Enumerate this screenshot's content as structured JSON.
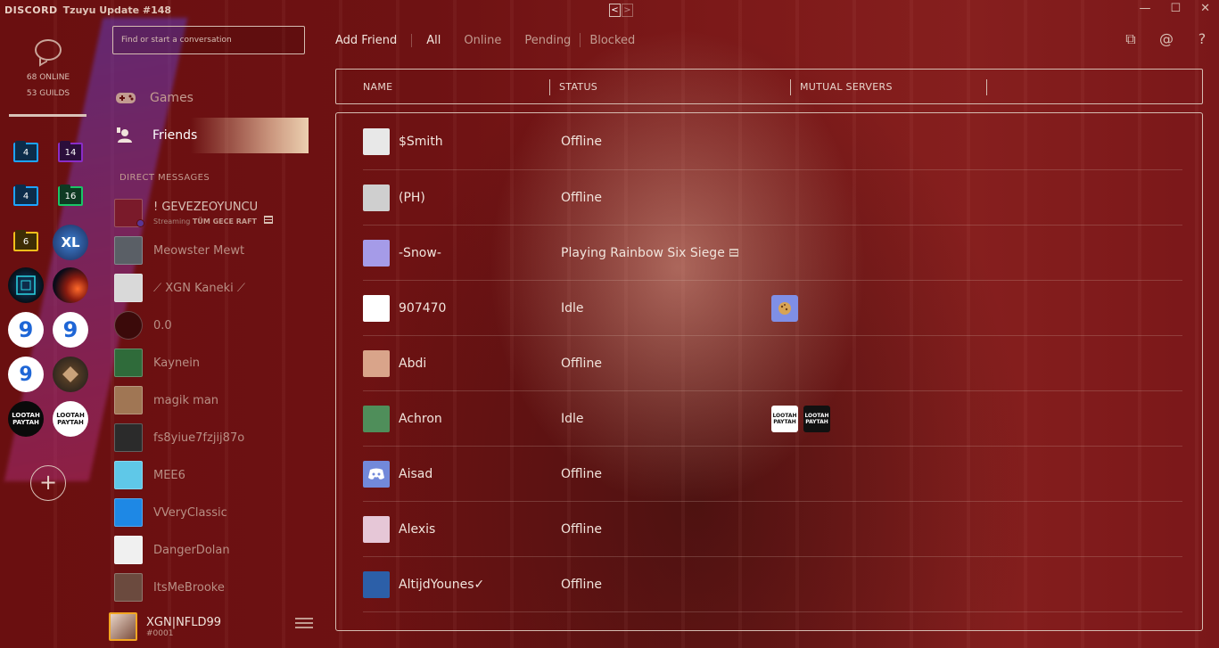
{
  "titlebar": {
    "logo": "DISCORD",
    "title": "Tzuyu Update #148",
    "back": "<",
    "forward": ">",
    "minimize": "—",
    "maximize": "☐",
    "close": "✕"
  },
  "guilds": {
    "online": "68 ONLINE",
    "count": "53 GUILDS",
    "folders": [
      {
        "label": "4",
        "color": "#1ea3ff"
      },
      {
        "label": "14",
        "color": "#8a2cc7"
      },
      {
        "label": "4",
        "color": "#1ea3ff"
      },
      {
        "label": "16",
        "color": "#19c567"
      },
      {
        "label": "6",
        "color": "#f2be1b"
      }
    ],
    "icons": [
      {
        "name": "XL",
        "label": "XL"
      },
      {
        "name": "tunnel"
      },
      {
        "name": "planet"
      },
      {
        "name": "9",
        "label": "9"
      },
      {
        "name": "9-alt",
        "label": "9"
      },
      {
        "name": "9-stack",
        "label": "9"
      },
      {
        "name": "diamond"
      },
      {
        "name": "lootah-1",
        "label": "LOOTAH PAYTAH"
      },
      {
        "name": "lootah-2",
        "label": "LOOTAH PAYTAH"
      }
    ],
    "add": "+"
  },
  "channels": {
    "search_placeholder": "Find or start a conversation",
    "games": "Games",
    "friends": "Friends",
    "dm_header": "DIRECT MESSAGES",
    "dms": [
      {
        "name": "! GEVEZEOYUNCU",
        "sub_prefix": "Streaming",
        "sub_bold": "TÜM GECE RAFT",
        "color": "#7a1a2a"
      },
      {
        "name": "Meowster Mewt",
        "color": "#5a5f66"
      },
      {
        "name": "⟋ XGN Kaneki ⟋",
        "color": "#d9d9d9"
      },
      {
        "name": "0.0",
        "color": "#3b0a0a"
      },
      {
        "name": "Kaynein",
        "color": "#2f6b3a"
      },
      {
        "name": "magik man",
        "color": "#a07654"
      },
      {
        "name": "fs8yiue7fzjij87o",
        "color": "#2b2b2b"
      },
      {
        "name": "MEE6",
        "color": "#5fc8e8"
      },
      {
        "name": "VVeryClassic",
        "color": "#1e88e5"
      },
      {
        "name": "DangerDolan",
        "color": "#f0f0f0"
      },
      {
        "name": "ItsMeBrooke",
        "color": "#6b4a3e"
      }
    ],
    "user": {
      "name": "XGN|NFLD99",
      "tag": "#0001"
    }
  },
  "main": {
    "tabs": {
      "add_friend": "Add Friend",
      "all": "All",
      "online": "Online",
      "pending": "Pending",
      "blocked": "Blocked"
    },
    "toolbar": {
      "new_dm": "⧉",
      "mentions": "@",
      "help": "?"
    },
    "columns": {
      "name": "NAME",
      "status": "STATUS",
      "mutual": "MUTUAL SERVERS"
    },
    "friends": [
      {
        "name": "$Smith",
        "status": "Offline",
        "avatar_color": "#e8e8e8",
        "mutuals": []
      },
      {
        "name": "(PH)",
        "status": "Offline",
        "avatar_color": "#cfcfcf",
        "mutuals": []
      },
      {
        "name": "-Snow-",
        "status": "Playing Rainbow Six Siege",
        "game_icon": true,
        "avatar_color": "#a59be8",
        "mutuals": []
      },
      {
        "name": "907470",
        "status": "Idle",
        "avatar_color": "#ffffff",
        "mutuals": [
          {
            "label": "",
            "color": "#7f8fe6"
          }
        ]
      },
      {
        "name": "Abdi",
        "status": "Offline",
        "avatar_color": "#d9a48a",
        "mutuals": []
      },
      {
        "name": "Achron",
        "status": "Idle",
        "avatar_color": "#4f8e5a",
        "mutuals": [
          {
            "label": "LOOTAH PAYTAH",
            "color": "#ffffff"
          },
          {
            "label": "LOOTAH PAYTAH",
            "color": "#111111"
          }
        ]
      },
      {
        "name": "Aisad",
        "status": "Offline",
        "avatar_color": "#7289da",
        "mutuals": []
      },
      {
        "name": "Alexis",
        "status": "Offline",
        "avatar_color": "#e6c7d7",
        "mutuals": []
      },
      {
        "name": "AltijdYounes✓",
        "status": "Offline",
        "avatar_color": "#2c5fa8",
        "mutuals": []
      }
    ]
  }
}
